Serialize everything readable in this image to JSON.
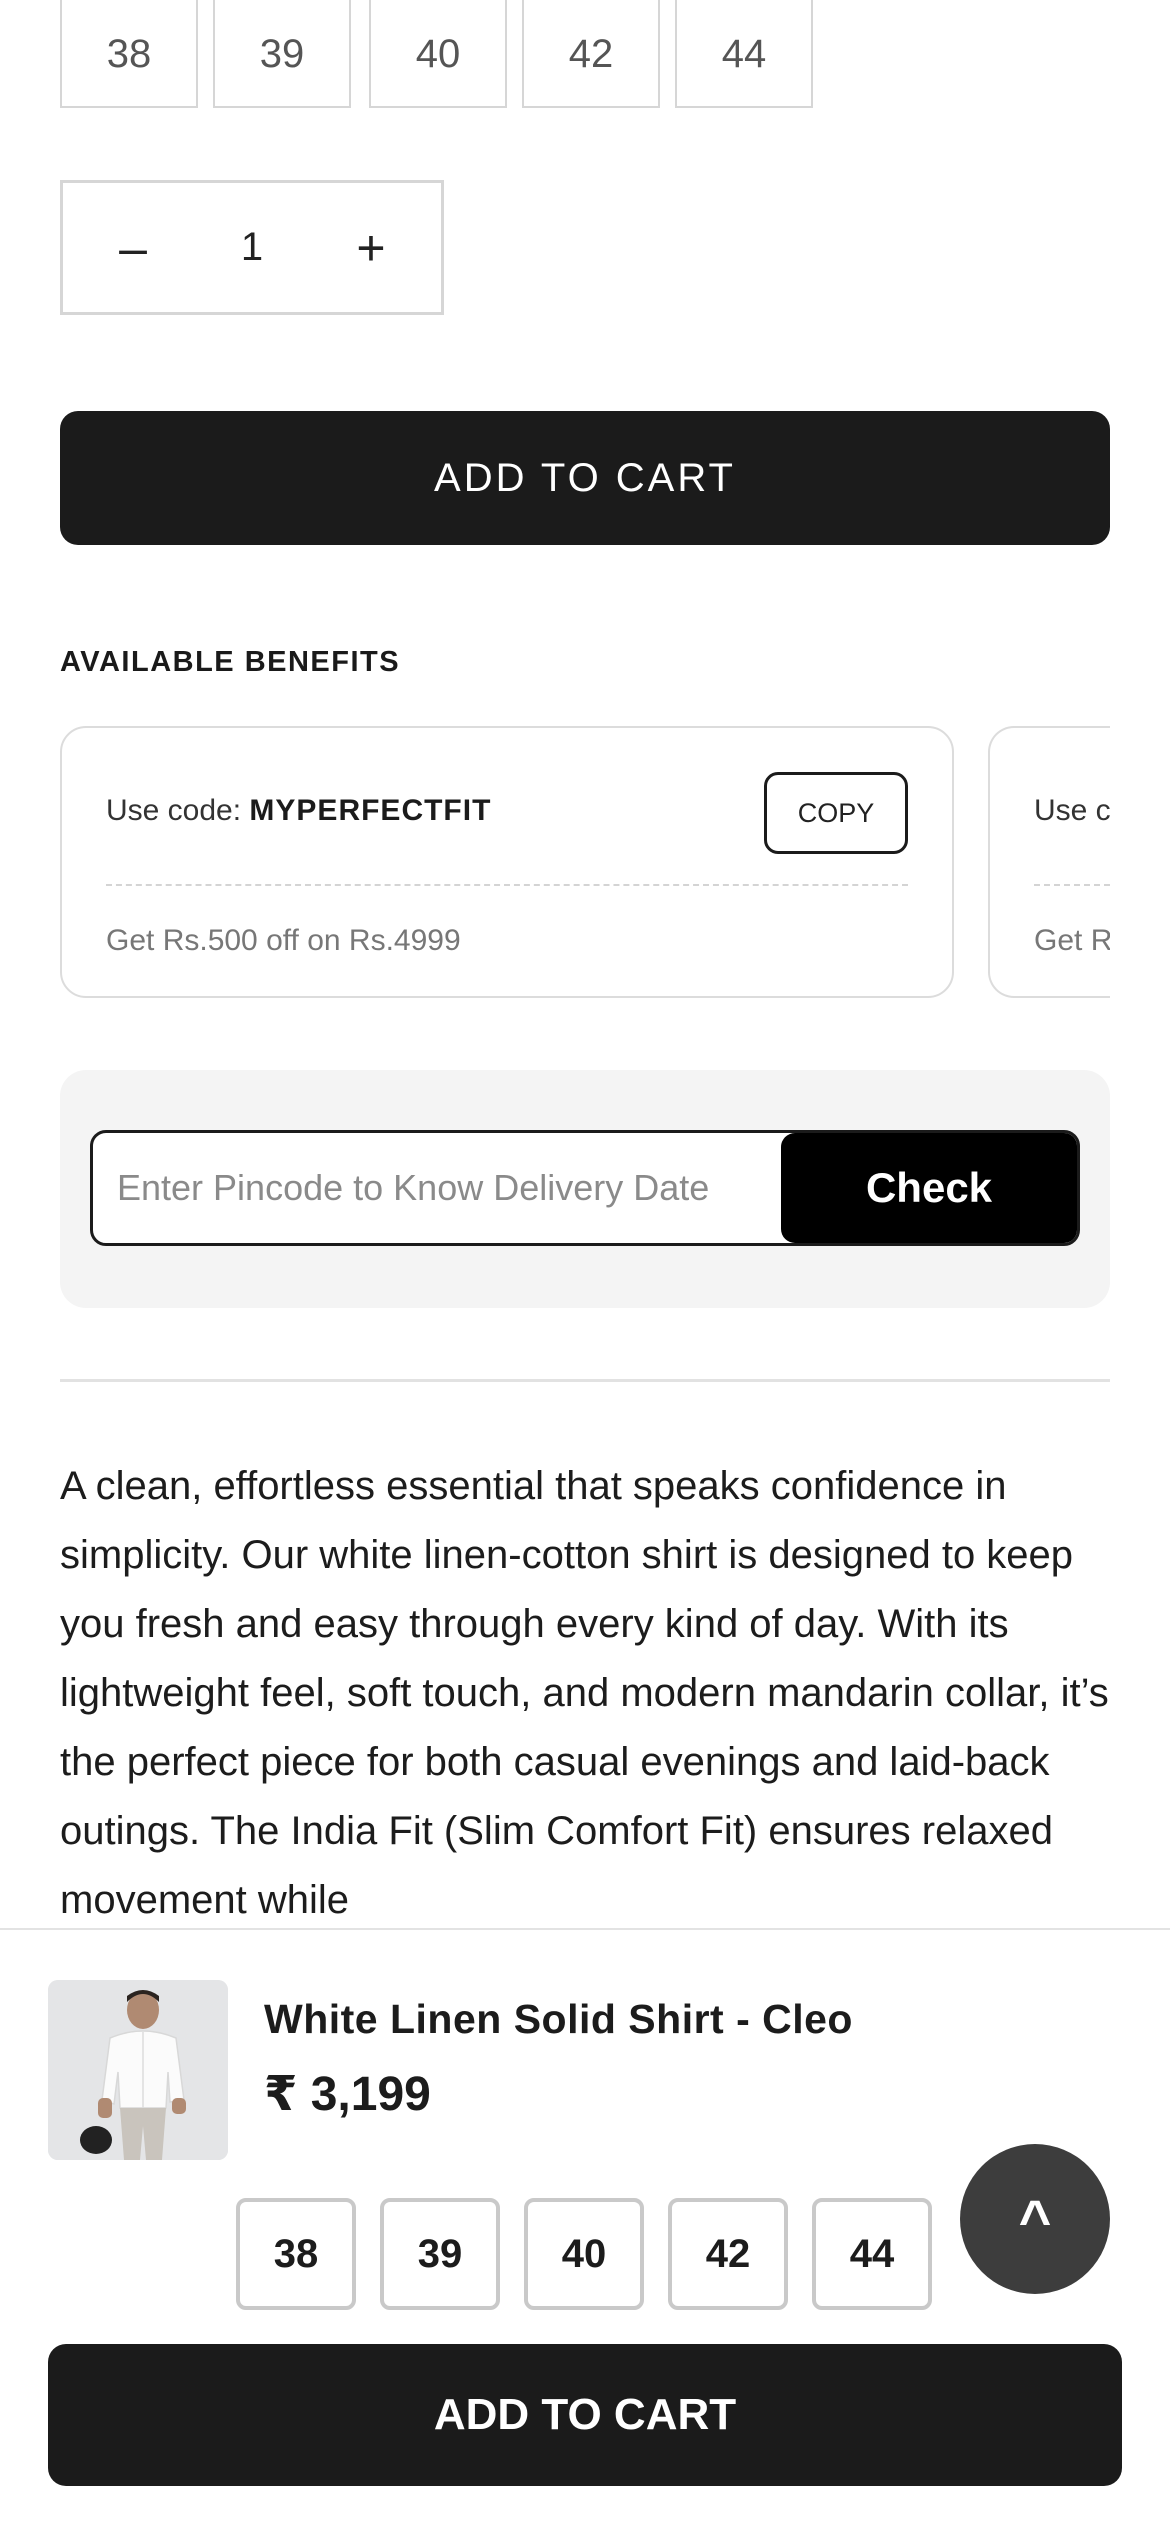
{
  "sizes": [
    "38",
    "39",
    "40",
    "42",
    "44"
  ],
  "quantity": {
    "minus_label": "–",
    "value": "1",
    "plus_label": "+"
  },
  "add_to_cart_label": "ADD TO CART",
  "benefits": {
    "heading": "AVAILABLE BENEFITS",
    "coupons": [
      {
        "prefix": "Use code: ",
        "code": "MYPERFECTFIT",
        "copy_label": "COPY",
        "description": "Get Rs.500 off on Rs.4999"
      },
      {
        "prefix": "Use c",
        "description": "Get R"
      }
    ]
  },
  "pincode": {
    "placeholder": "Enter Pincode to Know Delivery Date",
    "check_label": "Check"
  },
  "description": "A clean, effortless essential that speaks confidence in simplicity. Our white linen-cotton shirt is designed to keep you fresh and easy through every kind of day. With its lightweight feel, soft touch, and modern mandarin collar, it’s the perfect piece for both casual evenings and laid-back outings. The India Fit (Slim Comfort Fit) ensures relaxed movement while",
  "sticky_bar": {
    "product_name": "White Linen Solid Shirt - Cleo",
    "price": "₹ 3,199",
    "sizes": [
      "38",
      "39",
      "40",
      "42",
      "44"
    ],
    "scroll_top_label": "^",
    "add_to_cart_label": "ADD TO CART"
  },
  "icons": {
    "thumbnail": "product-thumbnail-shirt",
    "scroll_top": "chevron-up-icon"
  }
}
